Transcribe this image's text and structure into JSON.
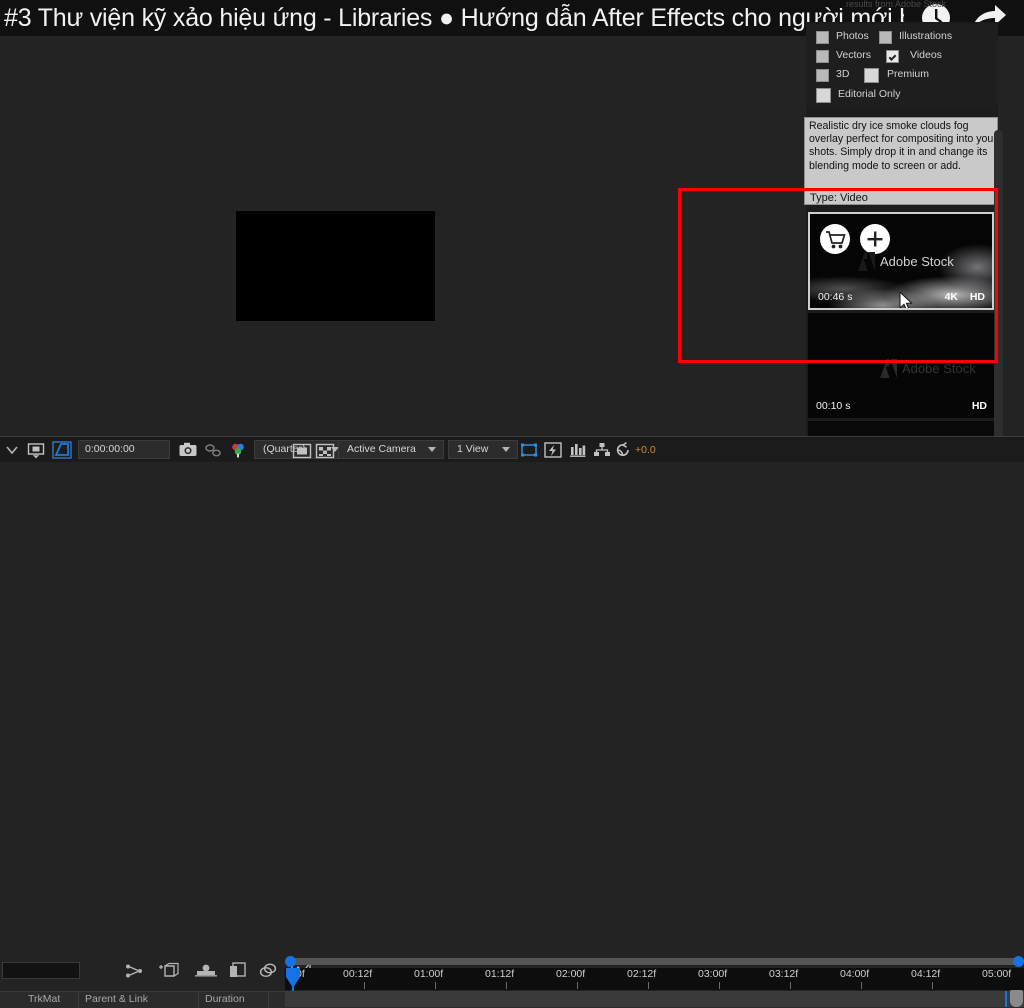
{
  "titlebar": {
    "title": "#3 Thư viện kỹ xảo hiệu ứng - Libraries ● Hướng dẫn After Effects cho người mới b...",
    "clock_icon": "clock-icon",
    "share_icon": "share-arrow-icon"
  },
  "stock_panel": {
    "ghost_header": "results from Adobe Stock",
    "filters": [
      {
        "label": "Photos",
        "checked": false
      },
      {
        "label": "Illustrations",
        "checked": false
      },
      {
        "label": "Vectors",
        "checked": false
      },
      {
        "label": "Videos",
        "checked": true
      },
      {
        "label": "3D",
        "checked": false
      },
      {
        "label": "Premium",
        "checked": false
      },
      {
        "label": "Editorial Only",
        "checked": false
      }
    ],
    "tooltip": {
      "description": "Realistic dry ice smoke clouds fog overlay perfect for compositing into your shots. Simply drop it in and change its blending mode to screen or add.",
      "type_label": "Type: Video"
    },
    "results": [
      {
        "duration": "00:46 s",
        "resolution_4k": "4K",
        "resolution_hd": "HD",
        "watermark": "Adobe Stock",
        "cart_icon": "shopping-cart-icon",
        "add_icon": "plus-icon",
        "selected": true
      },
      {
        "duration": "00:10 s",
        "resolution_4k": "",
        "resolution_hd": "HD",
        "watermark": "Adobe Stock",
        "selected": false
      }
    ]
  },
  "annotation": {
    "name": "red-highlight-rectangle",
    "color": "#ff0000"
  },
  "viewer_toolbar": {
    "menu_icon": "chevron-down-icon",
    "roi_icon": "region-of-interest-icon",
    "transparency_grid_icon": "transparency-grid-icon",
    "timecode": "0:00:00:00",
    "snapshot_icon": "camera-icon",
    "show_snapshot_icon": "show-snapshot-icon",
    "channels_icon": "color-channels-icon",
    "resolution": "(Quarter)",
    "region_icon": "region-icon",
    "alpha_icon": "alpha-checker-icon",
    "camera_view": "Active Camera",
    "view_layout": "1 View",
    "pixel_aspect_icon": "pixel-aspect-icon",
    "fast_previews_icon": "fast-previews-icon",
    "timeline_icon": "timeline-graph-icon",
    "comp_flowchart_icon": "comp-flowchart-icon",
    "reset_exposure_icon": "reset-exposure-icon",
    "exposure_value": "+0.0",
    "exposure_color": "#d08a3c",
    "accent_color": "#1473e6"
  },
  "timeline": {
    "search_placeholder": "",
    "tool_icons": [
      "shy-layers-icon",
      "frame-blending-icon",
      "motion-blur-icon",
      "adjustment-layer-icon",
      "graph-editor-icon",
      "brainstorm-icon"
    ],
    "column_headers": [
      "TrkMat",
      "Parent & Link",
      "Duration"
    ],
    "ruler_labels": [
      "0f",
      "00:12f",
      "01:00f",
      "01:12f",
      "02:00f",
      "02:12f",
      "03:00f",
      "03:12f",
      "04:00f",
      "04:12f",
      "05:00f"
    ],
    "playhead_position": "0f"
  }
}
